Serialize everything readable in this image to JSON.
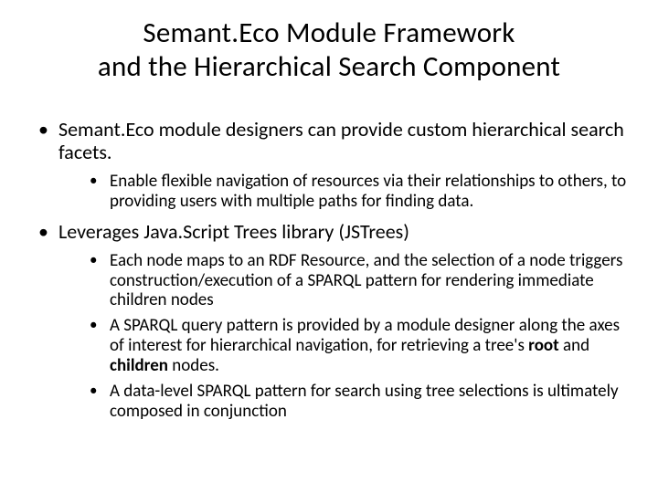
{
  "title": {
    "line1": "Semant.Eco Module Framework",
    "line2": "and the Hierarchical Search Component"
  },
  "bullets": {
    "b1": "Semant.Eco module designers can provide custom hierarchical search facets.",
    "b1_1": "Enable flexible navigation of resources  via their relationships to others, to providing users with multiple paths for finding data.",
    "b2": "Leverages Java.Script Trees library (JSTrees)",
    "b2_1": "Each node maps to an RDF Resource, and the selection of a node triggers construction/execution of a SPARQL pattern for rendering immediate children nodes",
    "b2_2_pre": " A SPARQL query pattern is provided by a module designer along the axes of interest for hierarchical navigation, for retrieving a tree's ",
    "b2_2_root": "root",
    "b2_2_and": " and ",
    "b2_2_children": "children",
    "b2_2_post": " nodes.",
    "b2_3": "A data-level SPARQL pattern for search using tree selections is ultimately composed in conjunction"
  }
}
